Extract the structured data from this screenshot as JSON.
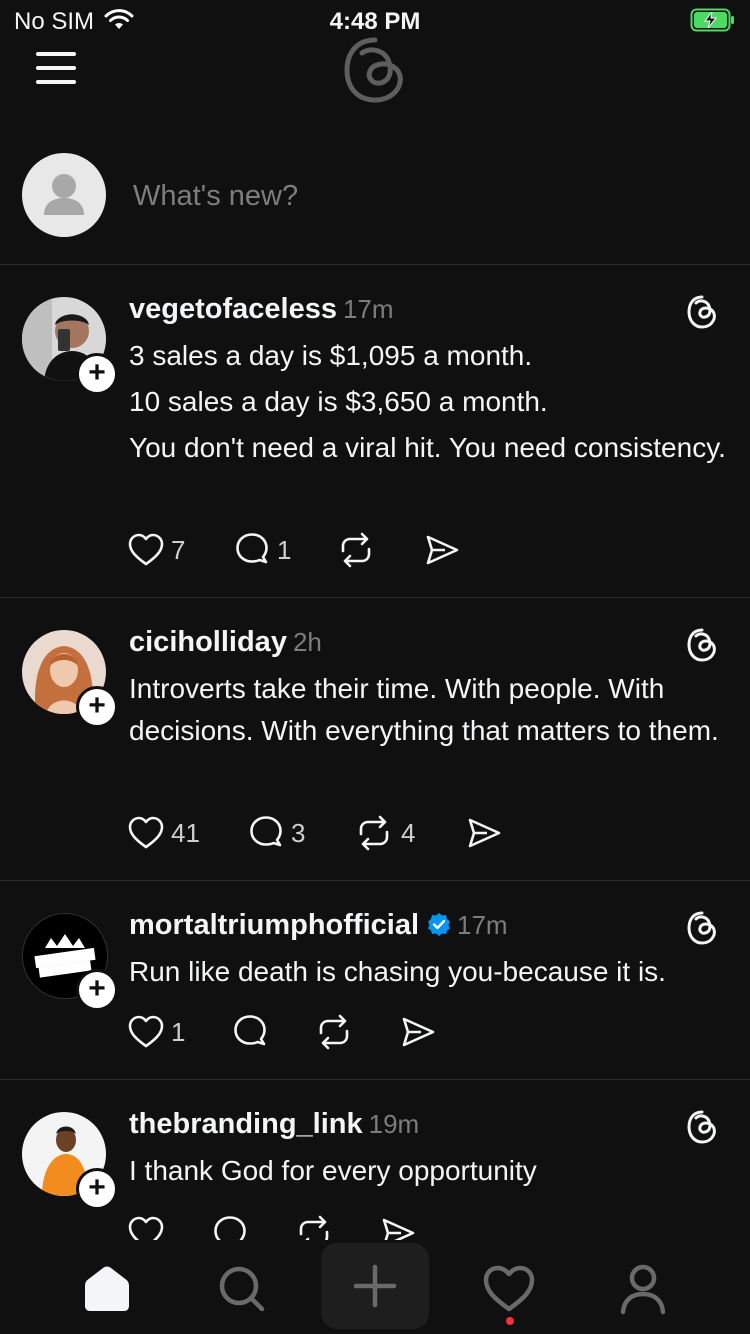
{
  "status_bar": {
    "carrier": "No SIM",
    "time": "4:48 PM"
  },
  "composer": {
    "placeholder": "What's new?"
  },
  "posts": [
    {
      "username": "vegetofaceless",
      "age": "17m",
      "verified": false,
      "lines": [
        "3 sales a day is $1,095 a month.",
        "10 sales a day is $3,650 a month.",
        "You don't need a viral hit. You need consistency."
      ],
      "likes": "7",
      "replies": "1",
      "reposts": "",
      "avatar_color": "#8a6a55"
    },
    {
      "username": "ciciholliday",
      "age": "2h",
      "verified": false,
      "lines": [
        "Introverts take their time. With people. With decisions. With everything that matters to them."
      ],
      "likes": "41",
      "replies": "3",
      "reposts": "4",
      "avatar_color": "#d4926a"
    },
    {
      "username": "mortaltriumphofficial",
      "age": "17m",
      "verified": true,
      "lines": [
        "Run like death is chasing you-because it is."
      ],
      "likes": "1",
      "replies": "",
      "reposts": "",
      "avatar_color": "#000000"
    },
    {
      "username": "thebranding_link",
      "age": "19m",
      "verified": false,
      "lines": [
        "I thank God for every opportunity"
      ],
      "likes": "",
      "replies": "",
      "reposts": "",
      "avatar_color": "#e8902a"
    }
  ],
  "icons": {
    "tabbar": [
      "home-icon",
      "search-icon",
      "create-icon",
      "activity-heart-icon",
      "profile-icon"
    ],
    "post_actions": [
      "like-heart-icon",
      "reply-bubble-icon",
      "repost-icon",
      "share-send-icon"
    ]
  },
  "colors": {
    "background": "#101010",
    "text": "#f3f5f7",
    "muted": "#7d7d7d",
    "verified": "#0095f6",
    "notification": "#ff3040",
    "battery": "#4cd964"
  }
}
